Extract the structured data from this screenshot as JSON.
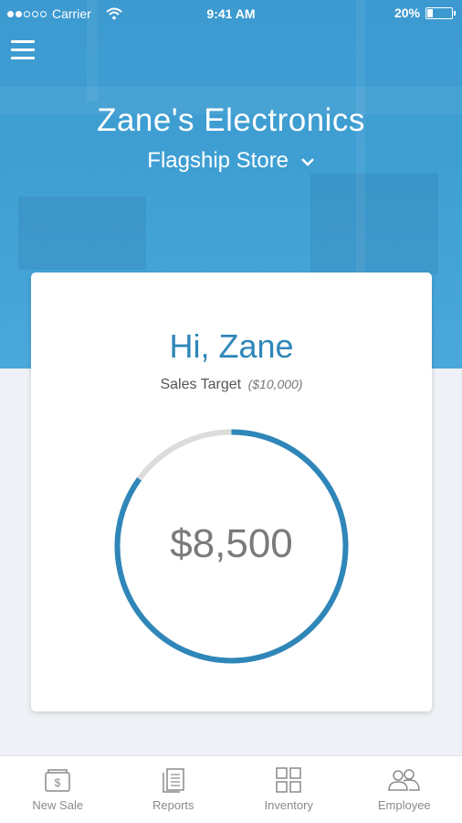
{
  "status_bar": {
    "carrier": "Carrier",
    "time": "9:41 AM",
    "battery": "20%",
    "battery_level": 0.2
  },
  "header": {
    "store_name": "Zane's Electronics",
    "location": "Flagship Store"
  },
  "card": {
    "greeting": "Hi, Zane",
    "target_label": "Sales Target",
    "target_amount": "($10,000)",
    "current_sales": "$8,500",
    "progress": 0.85
  },
  "colors": {
    "accent": "#2f86b8",
    "ring_track": "#dcdcdc",
    "header": "#3f9fd3"
  },
  "bottom_nav": [
    {
      "label": "New Sale",
      "icon": "new-sale-icon"
    },
    {
      "label": "Reports",
      "icon": "reports-icon"
    },
    {
      "label": "Inventory",
      "icon": "inventory-icon"
    },
    {
      "label": "Employee",
      "icon": "employee-icon"
    }
  ]
}
